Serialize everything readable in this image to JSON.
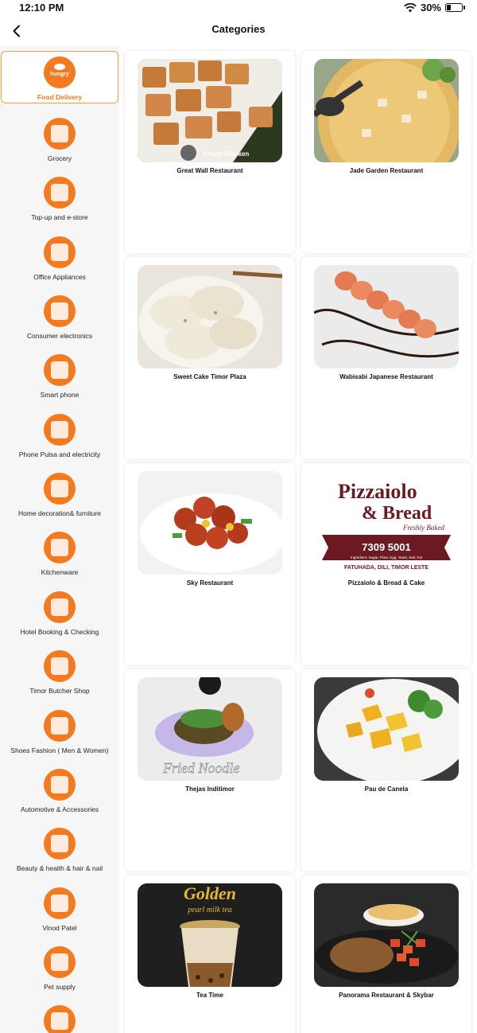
{
  "status_bar": {
    "time": "12:10 PM",
    "battery": "30%",
    "battery_level": 0.3
  },
  "header": {
    "title": "Categories"
  },
  "sidebar": {
    "items": [
      {
        "label": "Food Delivery",
        "icon": "hungry-logo-icon",
        "selected": true
      },
      {
        "label": "Grocery",
        "icon": "grocery-icon"
      },
      {
        "label": "Top-up and e-store",
        "icon": "topup-icon"
      },
      {
        "label": "Office Appliances",
        "icon": "office-appliances-icon"
      },
      {
        "label": "Consumer electronics",
        "icon": "electronics-icon"
      },
      {
        "label": "Smart phone",
        "icon": "smartphone-icon"
      },
      {
        "label": "Phone Pulsa and electricity",
        "icon": "phone-pulsa-icon"
      },
      {
        "label": "Home decoration& furniture",
        "icon": "home-decoration-icon"
      },
      {
        "label": "Kitchenware",
        "icon": "kitchenware-icon"
      },
      {
        "label": "Hotel Booking & Checking",
        "icon": "hotel-icon"
      },
      {
        "label": "Timor Butcher Shop",
        "icon": "butcher-icon"
      },
      {
        "label": "Shoes Fashion ( Men & Women)",
        "icon": "shoes-icon"
      },
      {
        "label": "Automotive & Accessories",
        "icon": "automotive-icon"
      },
      {
        "label": "Beauty & health & hair & nail",
        "icon": "beauty-icon"
      },
      {
        "label": "Vinod Patel",
        "icon": "vinod-patel-icon"
      },
      {
        "label": "Pet supply",
        "icon": "pet-supply-icon"
      },
      {
        "label": "",
        "icon": "baby-care-icon"
      }
    ]
  },
  "restaurants": [
    {
      "name": "Great Wall Restaurant",
      "image": "crispy-chicken-photo",
      "image_text": "Crispy Chicken"
    },
    {
      "name": "Jade Garden Restaurant",
      "image": "soup-photo"
    },
    {
      "name": "Sweet Cake Timor Plaza",
      "image": "dumplings-photo"
    },
    {
      "name": "Wabisabi Japanese Restaurant",
      "image": "sushi-roll-photo"
    },
    {
      "name": "Sky Restaurant",
      "image": "sweet-sour-pork-photo"
    },
    {
      "name": "Pizzaiolo & Bread & Cake",
      "image": "pizzaiolo-logo",
      "logo": {
        "line1": "Pizzaiolo",
        "line2": "& Bread",
        "tagline": "Freshly Baked",
        "phone": "7309 5001",
        "ingredients": "Ingredient: Sugar, Flour, Egg, Yeast, Salt, Fat",
        "location": "FATUHADA, DILI, TIMOR LESTE"
      }
    },
    {
      "name": "Thejas Inditimor",
      "image": "fried-noodle-photo",
      "image_text": "Fried Noodle"
    },
    {
      "name": "Pau de Canela",
      "image": "skewers-photo"
    },
    {
      "name": "Tea Time",
      "image": "milk-tea-photo",
      "image_text": "Golden",
      "image_subtext": "pearl milk tea"
    },
    {
      "name": "Panorama Restaurant & Skybar",
      "image": "grilled-chicken-photo"
    }
  ],
  "colors": {
    "accent": "#f47a20",
    "selected_border": "#f7a23a",
    "sidebar_bg": "#f6f6f6"
  }
}
